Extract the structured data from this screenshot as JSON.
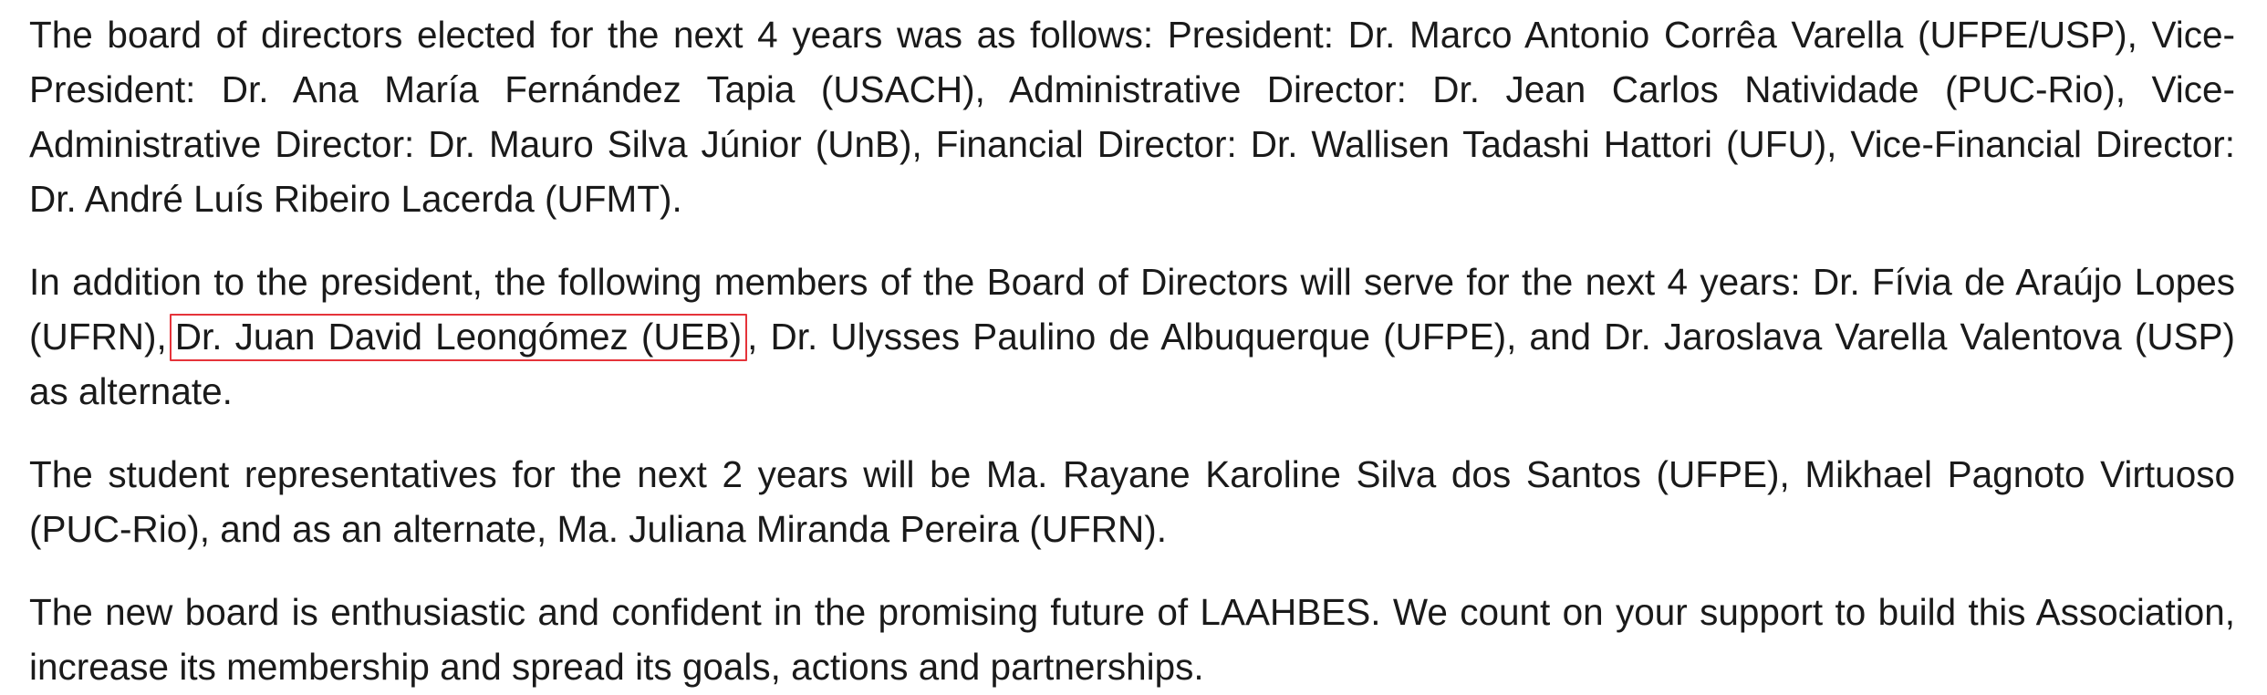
{
  "paragraphs": {
    "board": "The board of directors elected for the next 4 years was as follows: President: Dr. Marco Antonio Corrêa Varella (UFPE/USP), Vice-President: Dr. Ana María Fernández Tapia (USACH), Administrative Director: Dr. Jean Carlos Natividade (PUC-Rio), Vice-Administrative Director: Dr. Mauro Silva Júnior (UnB), Financial Director: Dr. Wallisen Tadashi Hattori (UFU), Vice-Financial Director: Dr. André Luís Ribeiro Lacerda (UFMT).",
    "members_before": "In addition to the president, the following members of the Board of Directors will serve for the next 4 years: Dr. Fívia de Araújo Lopes (UFRN),",
    "members_highlight": "Dr. Juan David Leongómez (UEB)",
    "members_after": ", Dr. Ulysses Paulino de Albuquerque (UFPE), and Dr. Jaroslava Varella Valentova (USP) as alternate.",
    "students": "The student representatives for the next 2 years will be Ma. Rayane Karoline Silva dos Santos (UFPE), Mikhael Pagnoto Virtuoso (PUC-Rio), and as an alternate, Ma. Juliana Miranda Pereira (UFRN).",
    "closing": "The new board is enthusiastic and confident in the promising future of LAAHBES. We count on your support to build this Association, increase its membership and spread its goals, actions and partnerships."
  },
  "colors": {
    "text": "#1a1a1a",
    "highlight_border": "#e5333a",
    "background": "#ffffff"
  }
}
